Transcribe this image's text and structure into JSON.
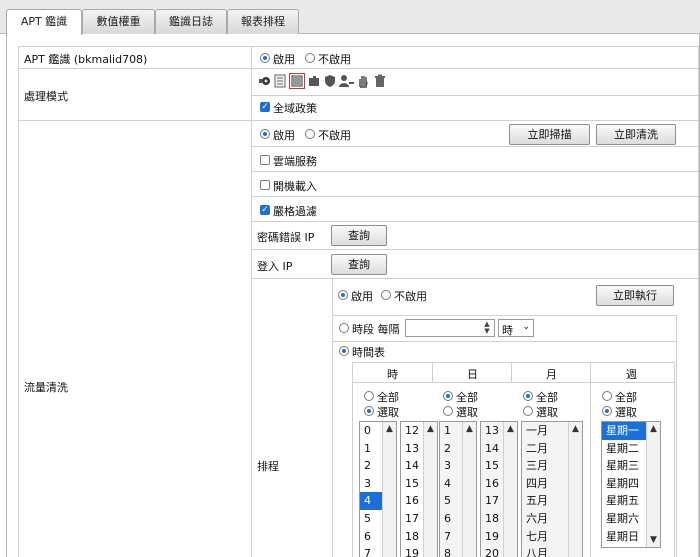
{
  "tabs": [
    {
      "label": "APT 鑑識",
      "active": true
    },
    {
      "label": "數值權重",
      "active": false
    },
    {
      "label": "鑑識日誌",
      "active": false
    },
    {
      "label": "報表排程",
      "active": false
    }
  ],
  "apt": {
    "label": "APT 鑑識 (bkmalid708)",
    "enable": "啟用",
    "disable": "不啟用",
    "enabled": true
  },
  "mode": {
    "label": "處理模式",
    "icons": [
      "camera-icon",
      "notes-icon",
      "calendar-icon",
      "puzzle-icon",
      "shield-icon",
      "user-key-icon",
      "hand-icon",
      "trash-icon"
    ],
    "global_policy": "全域政策",
    "global_policy_checked": true
  },
  "traffic": {
    "label": "流量清洗",
    "enable": "啟用",
    "disable": "不啟用",
    "enabled": true,
    "scan_now": "立即掃描",
    "clean_now": "立即清洗",
    "cloud": "雲端服務",
    "cloud_checked": false,
    "boot_load": "開機載入",
    "boot_checked": false,
    "strict": "嚴格過濾",
    "strict_checked": true,
    "pwd_error_ip": "密碼錯誤 IP",
    "login_ip": "登入 IP",
    "query": "查詢"
  },
  "schedule": {
    "label": "排程",
    "enable": "啟用",
    "disable": "不啟用",
    "enabled": true,
    "run_now": "立即執行",
    "period": "時段 每隔",
    "period_unit": "時",
    "timetable": "時間表",
    "all": "全部",
    "select": "選取",
    "columns": [
      {
        "header": "時",
        "mode": "select",
        "list1": [
          "0",
          "1",
          "2",
          "3",
          "4",
          "5",
          "6",
          "7"
        ],
        "selected1": "4",
        "list2": [
          "12",
          "13",
          "14",
          "15",
          "16",
          "17",
          "18",
          "19"
        ]
      },
      {
        "header": "日",
        "mode": "all",
        "list1": [
          "1",
          "2",
          "3",
          "4",
          "5",
          "6",
          "7",
          "8"
        ],
        "list2": [
          "13",
          "14",
          "15",
          "16",
          "17",
          "18",
          "19",
          "20"
        ]
      },
      {
        "header": "月",
        "mode": "all",
        "list1": [
          "一月",
          "二月",
          "三月",
          "四月",
          "五月",
          "六月",
          "七月",
          "八月"
        ]
      },
      {
        "header": "週",
        "mode": "select",
        "list1": [
          "星期一",
          "星期二",
          "星期三",
          "星期四",
          "星期五",
          "星期六",
          "星期日"
        ],
        "selected1": "星期一"
      }
    ]
  }
}
